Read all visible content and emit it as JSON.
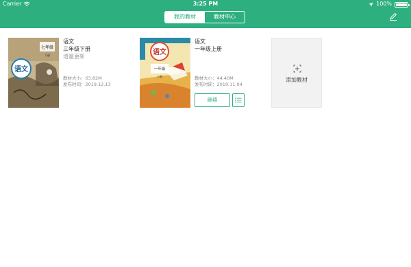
{
  "status_bar": {
    "carrier": "Carrier",
    "time": "3:25 PM",
    "battery": "100%",
    "battery_level": 1.0
  },
  "header": {
    "tabs": [
      {
        "label": "我的教材",
        "active": true
      },
      {
        "label": "教材中心",
        "active": false
      }
    ],
    "edit_icon": "pencil-icon"
  },
  "books": [
    {
      "subject": "语文",
      "grade": "三年级下册",
      "status": "增量更新",
      "size": "教材大小：63.82M",
      "published": "发布时间：2019.12.13",
      "cover_title": "语文",
      "cover_grade": "七年级",
      "cover_volume": "下册"
    },
    {
      "subject": "语文",
      "grade": "一年级上册",
      "size": "教材大小：44.40M",
      "published": "发布时间：2019.11.04",
      "continue_label": "继续",
      "list_icon": "list-icon",
      "cover_title": "语文",
      "cover_grade": "一年级",
      "cover_volume": "上册"
    }
  ],
  "add_card": {
    "label": "添加教材",
    "icon": "plus-square-icon"
  },
  "colors": {
    "accent": "#2eaf7f",
    "background": "#ffffff",
    "add_card_bg": "#f2f2f2"
  }
}
